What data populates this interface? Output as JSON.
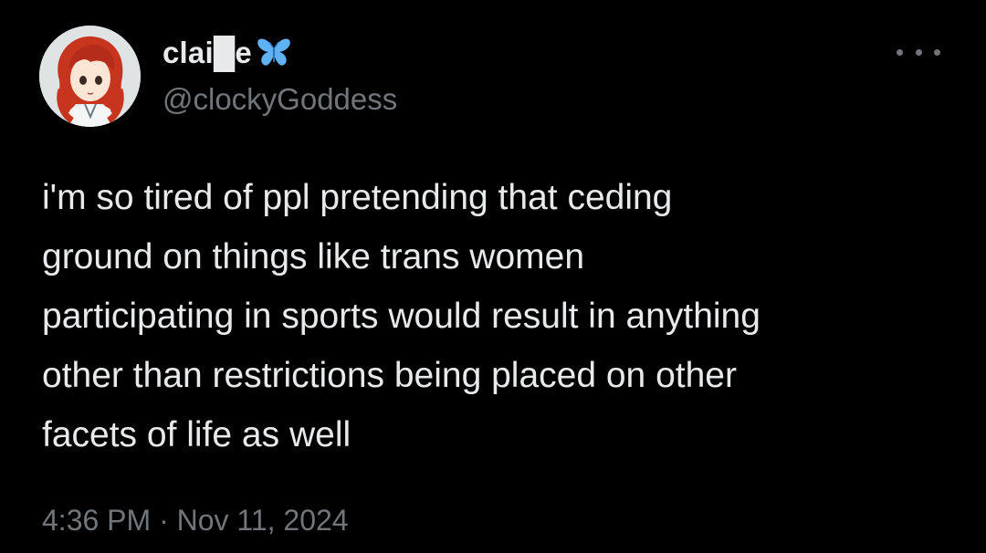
{
  "user": {
    "display_name": "clai█e",
    "handle": "@clockyGoddess",
    "badge_icon": "butterfly-icon",
    "badge_color": "#5fb2f5"
  },
  "tweet": {
    "lines": [
      "i'm so tired of ppl pretending that ceding",
      "ground on things like trans women",
      "participating in sports would result in anything",
      "other than restrictions being placed on other",
      "facets of life as well"
    ],
    "timestamp": "4:36 PM · Nov 11, 2024"
  },
  "menu": {
    "icon": "more-options-icon"
  },
  "colors": {
    "background": "#000000",
    "primary_text": "#e7e9ea",
    "secondary_text": "#71767b"
  }
}
